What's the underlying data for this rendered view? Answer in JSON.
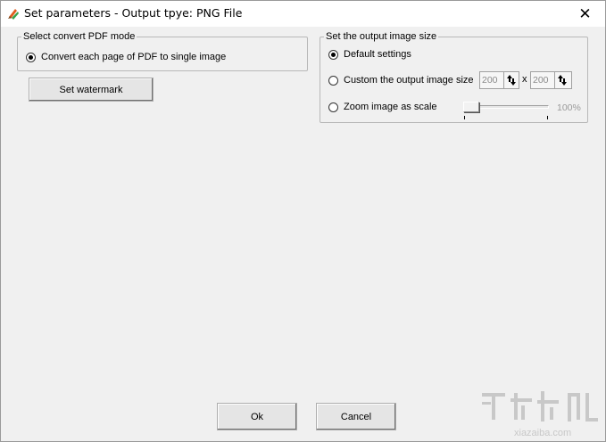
{
  "window": {
    "title": "Set parameters - Output tpye: PNG File",
    "close_glyph": "✕"
  },
  "convert_mode": {
    "group_label": "Select convert PDF mode",
    "option_label": "Convert each page of PDF to single image",
    "option_checked": true
  },
  "watermark_button": {
    "label": "Set watermark"
  },
  "output_size": {
    "group_label": "Set the output image size",
    "options": [
      {
        "label": "Default settings",
        "checked": true
      },
      {
        "label": "Custom the output image size",
        "checked": false
      },
      {
        "label": "Zoom image as scale",
        "checked": false
      }
    ],
    "width_value": "200",
    "height_value": "200",
    "separator": "x",
    "scale_value": "100%",
    "scale_level_fraction": 0.0
  },
  "buttons": {
    "ok": "Ok",
    "cancel": "Cancel"
  },
  "colors": {
    "window_bg": "#f0f0f0",
    "titlebar_bg": "#ffffff",
    "disabled_text": "#9a9a9a"
  }
}
